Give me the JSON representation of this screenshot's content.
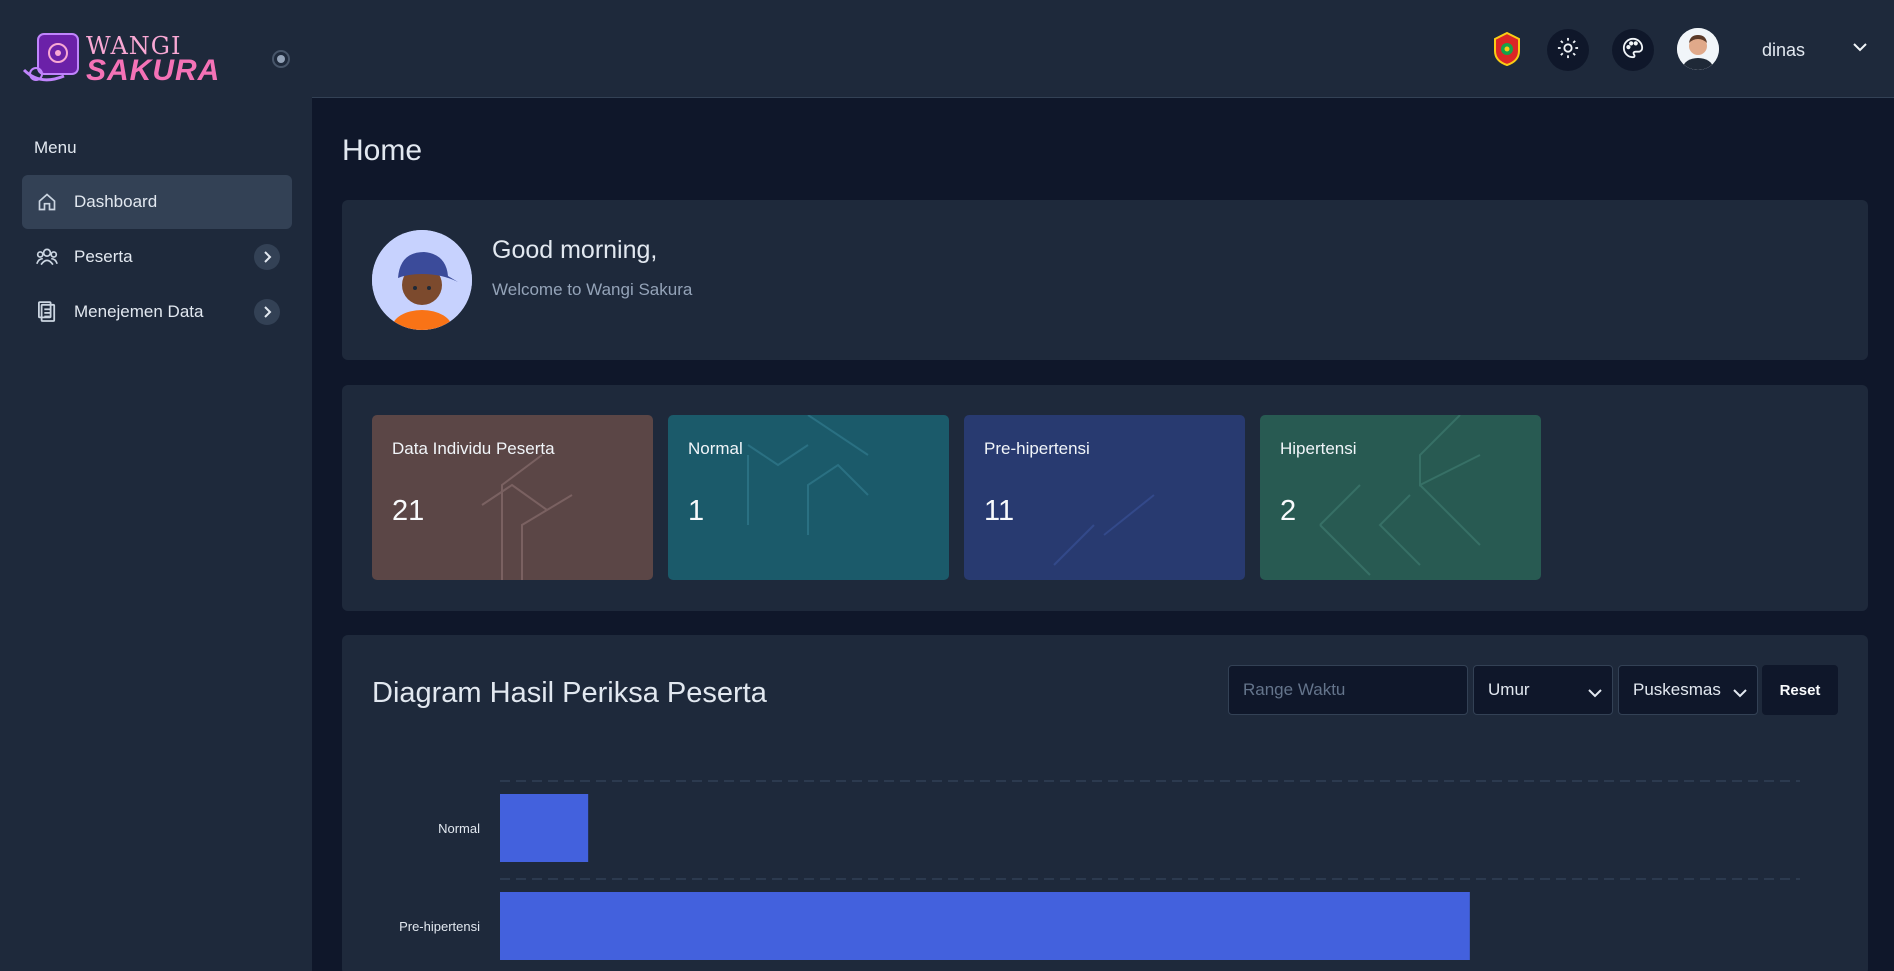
{
  "app": {
    "logo_top": "WANGI",
    "logo_bottom": "SAKURA"
  },
  "sidebar": {
    "menu_title": "Menu",
    "items": [
      {
        "label": "Dashboard",
        "icon": "home-icon",
        "active": true
      },
      {
        "label": "Peserta",
        "icon": "users-icon",
        "has_submenu": true
      },
      {
        "label": "Menejemen Data",
        "icon": "clipboard-icon",
        "has_submenu": true
      }
    ]
  },
  "header": {
    "icons": [
      "emblem-icon",
      "sun-icon",
      "palette-icon"
    ],
    "username": "dinas"
  },
  "main": {
    "page_title": "Home",
    "greeting": {
      "title": "Good morning,",
      "subtitle": "Welcome to Wangi Sakura"
    },
    "stats": [
      {
        "label": "Data Individu Peserta",
        "value": "21",
        "color": "#5b4646"
      },
      {
        "label": "Normal",
        "value": "1",
        "color": "#1b5a6a"
      },
      {
        "label": "Pre-hipertensi",
        "value": "11",
        "color": "#283a70"
      },
      {
        "label": "Hipertensi",
        "value": "2",
        "color": "#285a52"
      }
    ],
    "chart_section": {
      "title": "Diagram Hasil Periksa Peserta",
      "range_placeholder": "Range Waktu",
      "umur_label": "Umur",
      "puskesmas_label": "Puskesmas",
      "reset_label": "Reset"
    }
  },
  "colors": {
    "bg": "#0f172a",
    "panel": "#1e293b",
    "bar": "#4361dd"
  },
  "chart_data": {
    "type": "bar",
    "orientation": "horizontal",
    "categories": [
      "Normal",
      "Pre-hipertensi"
    ],
    "values": [
      1,
      11
    ],
    "xlim": [
      0,
      12
    ],
    "grid": true,
    "title": "",
    "xlabel": "",
    "ylabel": ""
  }
}
